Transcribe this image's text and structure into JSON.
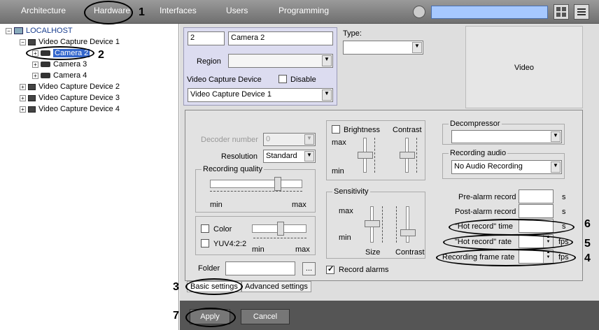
{
  "topbar": {
    "tabs": [
      "Architecture",
      "Hardware",
      "Interfaces",
      "Users",
      "Programming"
    ],
    "search_value": ""
  },
  "tree": {
    "root": "LOCALHOST",
    "device1": "Video Capture Device 1",
    "cameras": [
      "Camera 2",
      "Camera 3",
      "Camera 4"
    ],
    "device2": "Video Capture Device 2",
    "device3": "Video Capture Device 3",
    "device4": "Video Capture Device 4"
  },
  "props": {
    "id": "2",
    "name": "Camera 2",
    "region_label": "Region",
    "region_value": "",
    "type_label": "Type:",
    "type_value": "",
    "video_label": "Video",
    "vcd_label": "Video Capture Device",
    "disable_label": "Disable",
    "vcd_value": "Video Capture Device 1"
  },
  "basic": {
    "decoder_label": "Decoder number",
    "decoder_value": "0",
    "resolution_label": "Resolution",
    "resolution_value": "Standard",
    "rec_quality_label": "Recording quality",
    "min": "min",
    "max": "max",
    "color_label": "Color",
    "yuv_label": "YUV4:2:2",
    "folder_label": "Folder",
    "folder_value": "",
    "browse_label": "...",
    "brightness_label": "Brightness",
    "contrast_label": "Contrast",
    "sensitivity_label": "Sensitivity",
    "size_label": "Size",
    "record_alarms_label": "Record alarms",
    "decompressor_label": "Decompressor",
    "decompressor_value": "",
    "rec_audio_label": "Recording audio",
    "rec_audio_value": "No Audio Recording",
    "prealarm_label": "Pre-alarm record",
    "postalarm_label": "Post-alarm record",
    "hot_time_label": "\"Hot record\" time",
    "hot_rate_label": "\"Hot record\" rate",
    "frame_rate_label": "Recording frame rate",
    "unit_s": "s",
    "unit_fps": "fps"
  },
  "settings_tabs": [
    "Basic settings",
    "Advanced settings"
  ],
  "buttons": {
    "apply": "Apply",
    "cancel": "Cancel"
  },
  "callouts": [
    "1",
    "2",
    "3",
    "4",
    "5",
    "6",
    "7"
  ]
}
